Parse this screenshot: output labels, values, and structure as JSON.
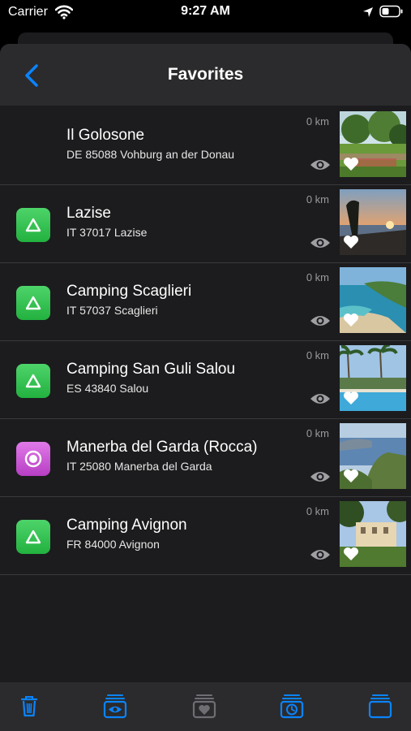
{
  "status_bar": {
    "carrier": "Carrier",
    "time": "9:27 AM"
  },
  "nav": {
    "title": "Favorites",
    "back_icon": "chevron-left-icon"
  },
  "colors": {
    "accent": "#0a84ff",
    "green": "#30c04b",
    "purple": "#c04fd0",
    "background": "#1c1c1e"
  },
  "favorites": [
    {
      "title": "Il Golosone",
      "subtitle": "DE 85088 Vohburg an der Donau",
      "distance": "0 km",
      "icon": "italy-flag-icon",
      "photo": "garden-photo"
    },
    {
      "title": "Lazise",
      "subtitle": "IT 37017 Lazise",
      "distance": "0 km",
      "icon": "camping-triangle-icon",
      "photo": "sunset-lake-photo"
    },
    {
      "title": "Camping Scaglieri",
      "subtitle": "IT 57037 Scaglieri",
      "distance": "0 km",
      "icon": "camping-triangle-icon",
      "photo": "beach-bay-photo"
    },
    {
      "title": "Camping San Guli Salou",
      "subtitle": "ES 43840 Salou",
      "distance": "0 km",
      "icon": "camping-triangle-icon",
      "photo": "pool-palms-photo"
    },
    {
      "title": "Manerba del Garda (Rocca)",
      "subtitle": "IT 25080 Manerba del Garda",
      "distance": "0 km",
      "icon": "poi-circle-icon",
      "photo": "cliff-lake-photo"
    },
    {
      "title": "Camping Avignon",
      "subtitle": "FR 84000 Avignon",
      "distance": "0 km",
      "icon": "camping-triangle-icon",
      "photo": "villa-photo"
    }
  ],
  "tab_bar": {
    "items": [
      {
        "icon": "trash-icon",
        "enabled": true
      },
      {
        "icon": "stack-eye-icon",
        "enabled": true
      },
      {
        "icon": "stack-heart-icon",
        "enabled": false
      },
      {
        "icon": "stack-clock-icon",
        "enabled": true
      },
      {
        "icon": "stack-icon",
        "enabled": true
      }
    ]
  }
}
